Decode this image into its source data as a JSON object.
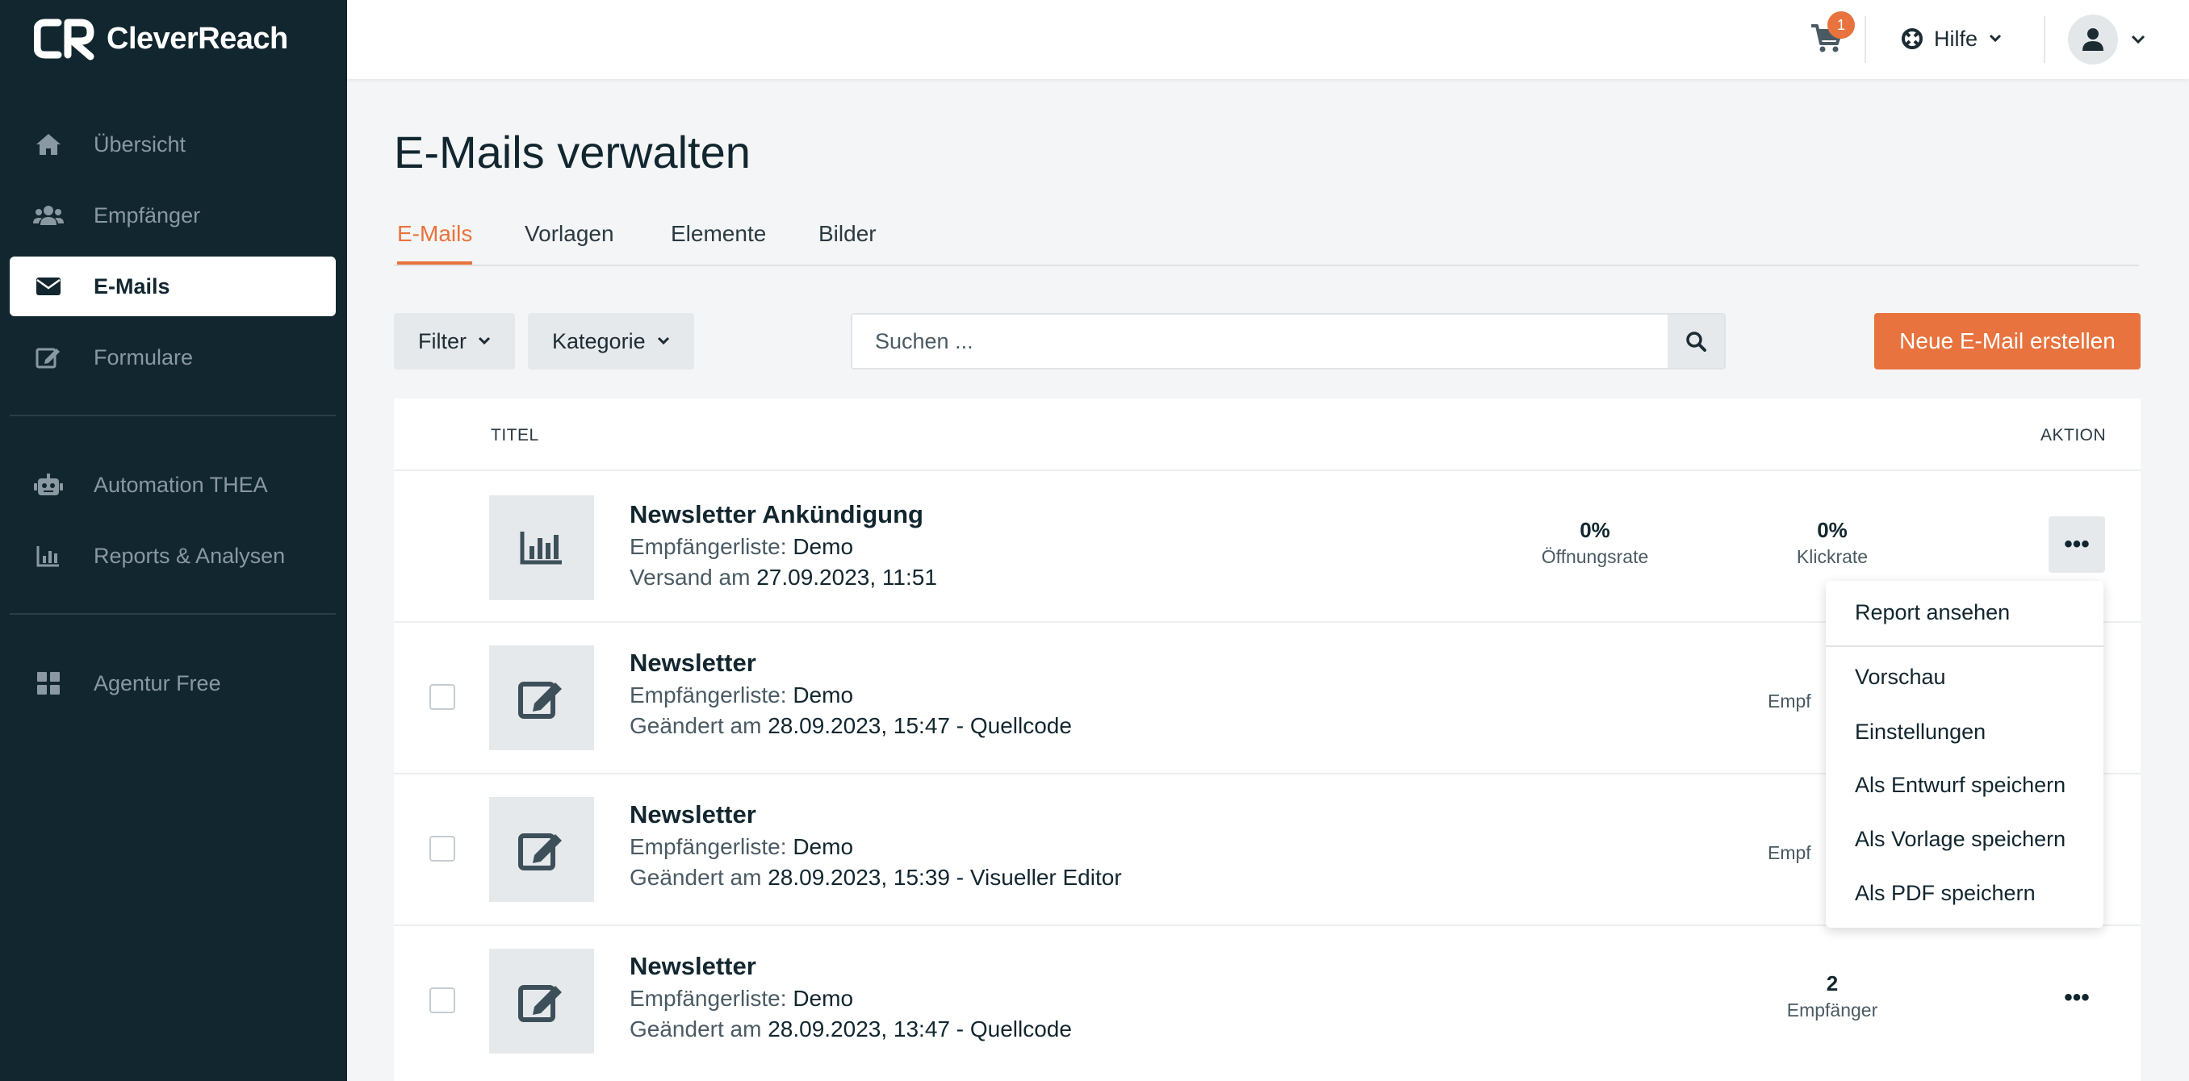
{
  "app": {
    "logo_text": "CleverReach"
  },
  "sidebar": {
    "items": [
      {
        "label": "Übersicht",
        "icon": "home-icon"
      },
      {
        "label": "Empfänger",
        "icon": "users-icon"
      },
      {
        "label": "E-Mails",
        "icon": "envelope-icon",
        "active": true
      },
      {
        "label": "Formulare",
        "icon": "edit-icon"
      },
      {
        "label": "Automation THEA",
        "icon": "robot-icon"
      },
      {
        "label": "Reports & Analysen",
        "icon": "bar-chart-icon"
      },
      {
        "label": "Agentur Free",
        "icon": "grid-icon"
      }
    ]
  },
  "topbar": {
    "cart_count": "1",
    "help_label": "Hilfe"
  },
  "page": {
    "title": "E-Mails verwalten",
    "tabs": [
      {
        "label": "E-Mails",
        "active": true
      },
      {
        "label": "Vorlagen"
      },
      {
        "label": "Elemente"
      },
      {
        "label": "Bilder"
      }
    ]
  },
  "toolbar": {
    "filter_label": "Filter",
    "category_label": "Kategorie",
    "search_placeholder": "Suchen ...",
    "new_email_label": "Neue E-Mail erstellen"
  },
  "table": {
    "col_title": "TITEL",
    "col_action": "AKTION",
    "rows": [
      {
        "title": "Newsletter Ankündigung",
        "list_prefix": "Empfängerliste:",
        "list_name": "Demo",
        "date_prefix": "Versand am",
        "date_value": "27.09.2023, 11:51",
        "stat1_value": "0%",
        "stat1_label": "Öffnungsrate",
        "stat2_value": "0%",
        "stat2_label": "Klickrate"
      },
      {
        "title": "Newsletter",
        "list_prefix": "Empfängerliste:",
        "list_name": "Demo",
        "date_prefix": "Geändert am",
        "date_value": "28.09.2023, 15:47 - Quellcode",
        "stat_label_partial": "Empf"
      },
      {
        "title": "Newsletter",
        "list_prefix": "Empfängerliste:",
        "list_name": "Demo",
        "date_prefix": "Geändert am",
        "date_value": "28.09.2023, 15:39 - Visueller Editor",
        "stat_label_partial": "Empf"
      },
      {
        "title": "Newsletter",
        "list_prefix": "Empfängerliste:",
        "list_name": "Demo",
        "date_prefix": "Geändert am",
        "date_value": "28.09.2023, 13:47 - Quellcode",
        "stat_value": "2",
        "stat_label": "Empfänger"
      }
    ]
  },
  "menu": {
    "items": [
      "Report ansehen",
      "Vorschau",
      "Einstellungen",
      "Als Entwurf speichern",
      "Als Vorlage speichern",
      "Als PDF speichern"
    ]
  },
  "colors": {
    "accent": "#e8733e",
    "sidebar_bg": "#12262f"
  }
}
